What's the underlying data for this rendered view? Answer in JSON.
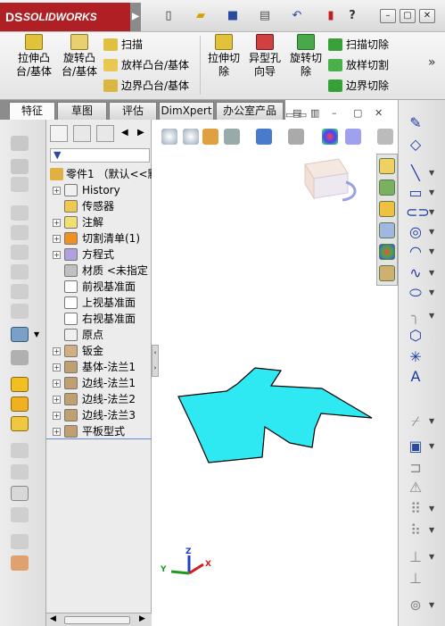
{
  "app": {
    "logo_prefix": "DS",
    "logo_text": "SOLIDWORKS"
  },
  "title_bar": {
    "new_icon": "new-document-icon",
    "open_icon": "open-folder-icon",
    "save_icon": "save-icon",
    "print_icon": "print-icon",
    "undo_icon": "undo-icon",
    "rebuild_icon": "traffic-light-icon",
    "help_icon": "help-icon",
    "help_glyph": "?",
    "minimize_glyph": "–",
    "restore_glyph": "▢",
    "close_glyph": "✕"
  },
  "ribbon": {
    "extrude_boss": "拉伸凸\n台/基体",
    "revolve_boss": "旋转凸\n台/基体",
    "sweep": "扫描",
    "loft_boss": "放样凸台/基体",
    "boundary_boss": "边界凸台/基体",
    "extrude_cut": "拉伸切\n除",
    "hole_wizard": "异型孔\n向导",
    "revolve_cut": "旋转切\n除",
    "swept_cut": "扫描切除",
    "lofted_cut": "放样切割",
    "boundary_cut": "边界切除",
    "more_glyph": "»"
  },
  "tabs": [
    {
      "label": "特征"
    },
    {
      "label": "草图"
    },
    {
      "label": "评估"
    },
    {
      "label": "DimXpert"
    },
    {
      "label": "办公室产品"
    }
  ],
  "tree": {
    "root": "零件1 （默认<<默",
    "items": [
      {
        "label": "History",
        "expand": "+"
      },
      {
        "label": "传感器",
        "expand": ""
      },
      {
        "label": "注解",
        "expand": "+"
      },
      {
        "label": "切割清单(1)",
        "expand": "+"
      },
      {
        "label": "方程式",
        "expand": "+"
      },
      {
        "label": "材质 <未指定",
        "expand": ""
      },
      {
        "label": "前视基准面",
        "expand": ""
      },
      {
        "label": "上视基准面",
        "expand": ""
      },
      {
        "label": "右视基准面",
        "expand": ""
      },
      {
        "label": "原点",
        "expand": ""
      },
      {
        "label": "钣金",
        "expand": "+"
      },
      {
        "label": "基体-法兰1",
        "expand": "+"
      },
      {
        "label": "边线-法兰1",
        "expand": "+"
      },
      {
        "label": "边线-法兰2",
        "expand": "+"
      },
      {
        "label": "边线-法兰3",
        "expand": "+"
      },
      {
        "label": "平板型式",
        "expand": "+"
      }
    ]
  },
  "colors": {
    "logo_bg": "#b01f24",
    "part_fill": "#2ee8f2",
    "axis_x": "#d21e1e",
    "axis_y": "#1e9a1e",
    "axis_z": "#1e3ed2"
  },
  "triad": {
    "x": "X",
    "y": "Y",
    "z": "Z"
  }
}
